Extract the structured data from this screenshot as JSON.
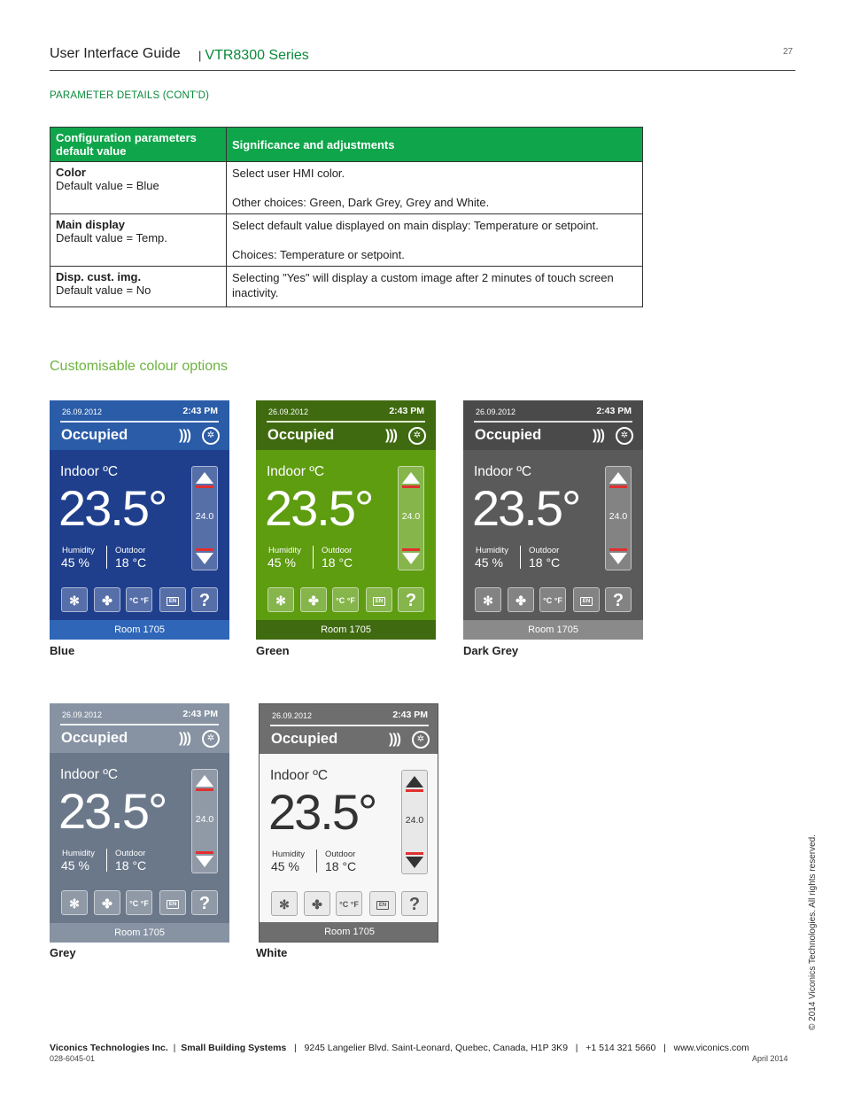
{
  "header": {
    "guide_title": "User Interface Guide",
    "separator": "|",
    "series": "VTR8300 Series",
    "page_number": "27"
  },
  "section_title": "PARAMETER DETAILS (CONT'D)",
  "table": {
    "col1_header": "Configuration parameters default value",
    "col2_header": "Significance and adjustments",
    "rows": [
      {
        "name": "Color",
        "default": "Default value = Blue",
        "desc1": "Select user HMI color.",
        "desc2": "Other choices: Green, Dark Grey, Grey and White."
      },
      {
        "name": "Main display",
        "default": "Default value = Temp.",
        "desc1": "Select default value displayed on main display: Temperature or setpoint.",
        "desc2": "Choices: Temperature or setpoint."
      },
      {
        "name": "Disp. cust. img.",
        "default": "Default value = No",
        "desc1": "Selecting \"Yes\" will display a custom image after 2 minutes of touch screen inactivity.",
        "desc2": ""
      }
    ]
  },
  "colour_title": "Customisable colour options",
  "thermostat": {
    "date": "26.09.2012",
    "time": "2:43 PM",
    "status": "Occupied",
    "indoor_label": "Indoor ºC",
    "temperature": "23.5°",
    "setpoint": "24.0",
    "humidity_label": "Humidity",
    "humidity_value": "45 %",
    "outdoor_label": "Outdoor",
    "outdoor_value": "18 °C",
    "lang_button": "EN",
    "help_button": "?",
    "units_button": "°C °F",
    "room": "Room 1705",
    "heat_icon": "heat-waves-icon",
    "fan_icon": "fan-icon"
  },
  "captions": [
    "Blue",
    "Green",
    "Dark Grey",
    "Grey",
    "White"
  ],
  "colors": {
    "brand_green": "#0fa54a",
    "blue": "#1f3f8c",
    "green": "#5e9c10",
    "dark_grey": "#5a5a5a",
    "grey": "#6b788a",
    "white": "#f7f7f7"
  },
  "footer": {
    "company": "Viconics Technologies Inc.",
    "division": "Small Building Systems",
    "address": "9245 Langelier Blvd. Saint-Leonard, Quebec, Canada, H1P 3K9",
    "phone": "+1 514 321 5660",
    "website": "www.viconics.com",
    "doc_code": "028-6045-01",
    "date": "April 2014",
    "copyright": "© 2014 Viconics Technologies. All rights reserved."
  }
}
